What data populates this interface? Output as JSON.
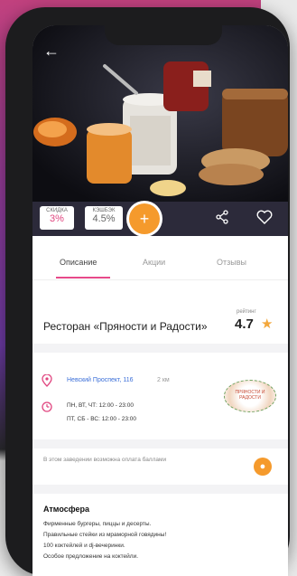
{
  "header": {
    "back_glyph": "←"
  },
  "stats": {
    "discount_label": "СКИДКА",
    "discount_value": "3%",
    "cashback_label": "КЭШБЭК",
    "cashback_value": "4.5%",
    "discount_color": "#e0457f",
    "fab_glyph": "+"
  },
  "tabs": [
    {
      "label": "Описание",
      "active": true
    },
    {
      "label": "Акции",
      "active": false
    },
    {
      "label": "Отзывы",
      "active": false
    }
  ],
  "restaurant": {
    "name": "Ресторан «Пряности и Радости»",
    "rating_label": "рейтинг",
    "rating": "4.7"
  },
  "info": {
    "address": "Невский Проспект, 116",
    "distance": "2 км",
    "hours_weekdays": "ПН, ВТ, ЧТ: 12:00 - 23:00",
    "hours_weekend": "ПТ, СБ - ВС: 12:00 - 23:00",
    "logo_text": "ПРЯНОСТИ И РАДОСТИ"
  },
  "points": {
    "text": "В этом заведении возможна оплата баллами"
  },
  "atmosphere": {
    "title": "Атмосфера",
    "lines": [
      "Фирменные бургеры, пиццы и десерты.",
      "Правильные стейки из мраморной говядины!",
      "100 коктейлей и dj-вечеринки.",
      "Особое предложение на коктейли."
    ]
  },
  "colors": {
    "accent": "#f59a2c",
    "brand_pink": "#e0457f",
    "link": "#3b6fd8"
  }
}
